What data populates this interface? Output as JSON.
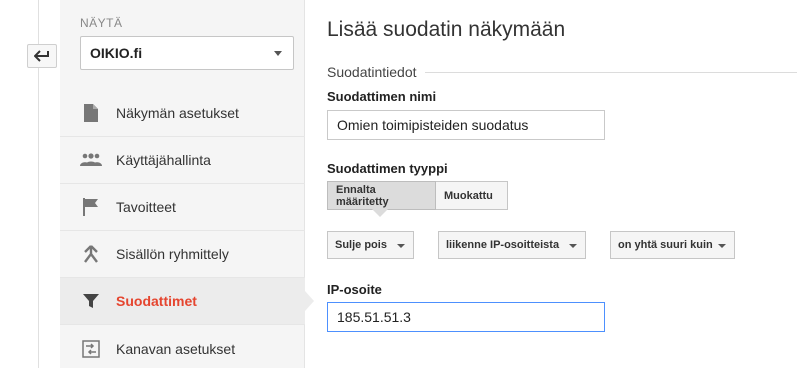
{
  "nav_back": {
    "icon": "back-arrow-icon"
  },
  "sidebar": {
    "view_label": "NÄYTÄ",
    "view_selected": "OIKIO.fi",
    "items": [
      {
        "label": "Näkymän asetukset",
        "icon": "document-icon",
        "active": false
      },
      {
        "label": "Käyttäjähallinta",
        "icon": "users-icon",
        "active": false
      },
      {
        "label": "Tavoitteet",
        "icon": "flag-icon",
        "active": false
      },
      {
        "label": "Sisällön ryhmittely",
        "icon": "grouping-icon",
        "active": false
      },
      {
        "label": "Suodattimet",
        "icon": "filter-icon",
        "active": true
      },
      {
        "label": "Kanavan asetukset",
        "icon": "channel-settings-icon",
        "active": false
      }
    ]
  },
  "main": {
    "title": "Lisää suodatin näkymään",
    "section_title": "Suodatintiedot",
    "filter_name_label": "Suodattimen nimi",
    "filter_name_value": "Omien toimipisteiden suodatus",
    "filter_type_label": "Suodattimen tyyppi",
    "type_options": [
      "Ennalta määritetty",
      "Muokattu"
    ],
    "type_selected": "Ennalta määritetty",
    "dropdowns": [
      "Sulje pois",
      "liikenne IP-osoitteista",
      "on yhtä suuri kuin"
    ],
    "ip_label": "IP-osoite",
    "ip_value": "185.51.51.3"
  },
  "colors": {
    "active_text": "#e5452f",
    "focus_border": "#4d90fe",
    "sidebar_bg": "#f5f5f5"
  }
}
